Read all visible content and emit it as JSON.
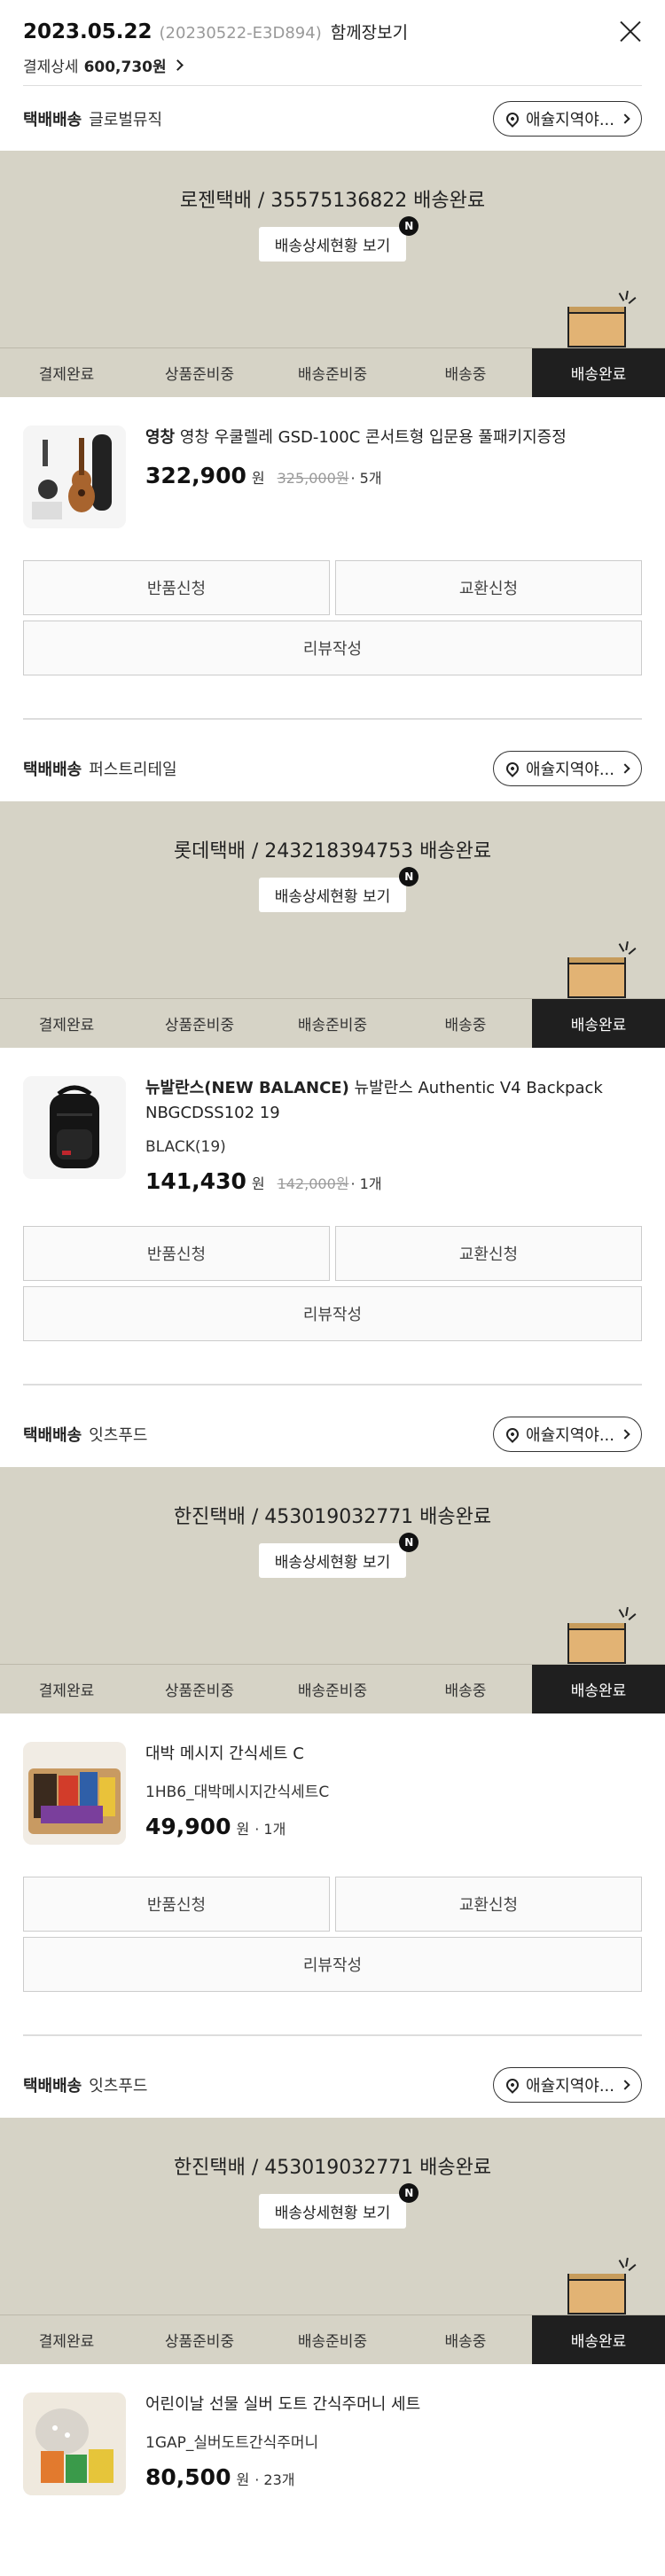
{
  "header": {
    "date": "2023.05.22",
    "order_no": "(20230522-E3D894)",
    "view_all": "함께장보기",
    "payment_label": "결제상세",
    "payment_amount": "600,730원"
  },
  "steps": [
    "결제완료",
    "상품준비중",
    "배송준비중",
    "배송중",
    "배송완료"
  ],
  "detail_button": "배송상세현황 보기",
  "new_badge": "N",
  "store_button": "애슐지역야...",
  "actions": {
    "return": "반품신청",
    "exchange": "교환신청",
    "review": "리뷰작성"
  },
  "sections": [
    {
      "ship_type": "택배배송",
      "seller": "글로벌뮤직",
      "courier": "로젠택배 / 35575136822 배송완료",
      "brand": "영창",
      "product": "영창 우쿨렐레 GSD-100C 콘서트형 입문용 풀패키지증정",
      "option": "",
      "price": "322,900",
      "won": "원",
      "original": "325,000원",
      "qty": "· 5개"
    },
    {
      "ship_type": "택배배송",
      "seller": "퍼스트리테일",
      "courier": "롯데택배 / 243218394753 배송완료",
      "brand": "뉴발란스(NEW BALANCE)",
      "product": "뉴발란스 Authentic V4 Backpack NBGCDSS102 19",
      "option": "BLACK(19)",
      "price": "141,430",
      "won": "원",
      "original": "142,000원",
      "qty": "· 1개"
    },
    {
      "ship_type": "택배배송",
      "seller": "잇츠푸드",
      "courier": "한진택배 / 453019032771 배송완료",
      "brand": "",
      "product": "대박 메시지 간식세트 C",
      "option": "1HB6_대박메시지간식세트C",
      "price": "49,900",
      "won": "원",
      "original": "",
      "qty": "· 1개"
    },
    {
      "ship_type": "택배배송",
      "seller": "잇츠푸드",
      "courier": "한진택배 / 453019032771 배송완료",
      "brand": "",
      "product": "어린이날 선물 실버 도트 간식주머니 세트",
      "option": "1GAP_실버도트간식주머니",
      "price": "80,500",
      "won": "원",
      "original": "",
      "qty": "· 23개"
    }
  ]
}
